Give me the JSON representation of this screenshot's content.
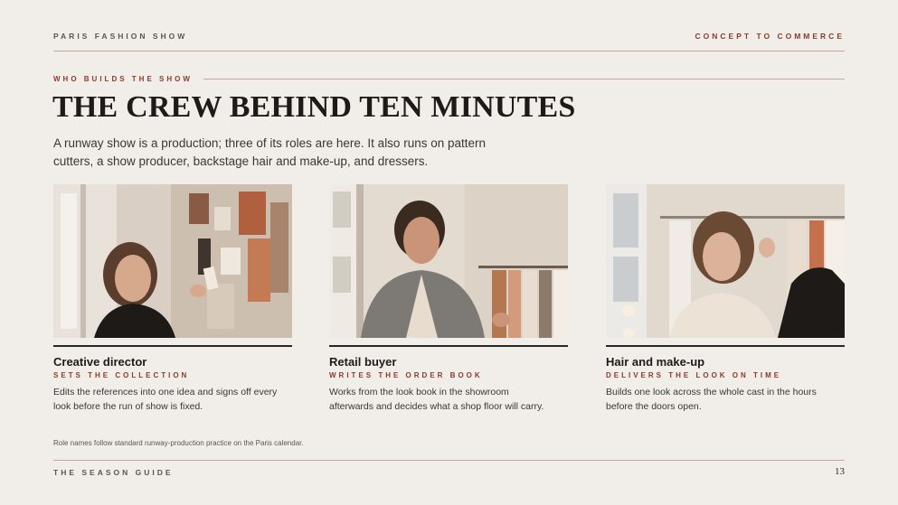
{
  "header": {
    "left": "PARIS FASHION SHOW",
    "right": "CONCEPT TO COMMERCE"
  },
  "section": {
    "eyebrow": "WHO BUILDS THE SHOW",
    "title": "THE CREW BEHIND TEN MINUTES",
    "intro": "A runway show is a production; three of its roles are here. It also runs on pattern cutters, a show producer, backstage hair and make-up, and dressers."
  },
  "roles": [
    {
      "title": "Creative director",
      "subtitle": "SETS THE COLLECTION",
      "description": "Edits the references into one idea and signs off every look before the run of show is fixed.",
      "photo": "creative-director-photo"
    },
    {
      "title": "Retail buyer",
      "subtitle": "WRITES THE ORDER BOOK",
      "description": "Works from the look book in the showroom afterwards and decides what a shop floor will carry.",
      "photo": "retail-buyer-photo"
    },
    {
      "title": "Hair and make-up",
      "subtitle": "DELIVERS THE LOOK ON TIME",
      "description": "Builds one look across the whole cast in the hours before the doors open.",
      "photo": "hair-makeup-photo"
    }
  ],
  "note": "Role names follow standard runway-production practice on the Paris calendar.",
  "footer": {
    "left": "THE SEASON GUIDE",
    "page": "13"
  },
  "colors": {
    "background": "#f1ede8",
    "accent": "#8a3b2c",
    "rule": "#c9a896",
    "text": "#2a2623"
  }
}
